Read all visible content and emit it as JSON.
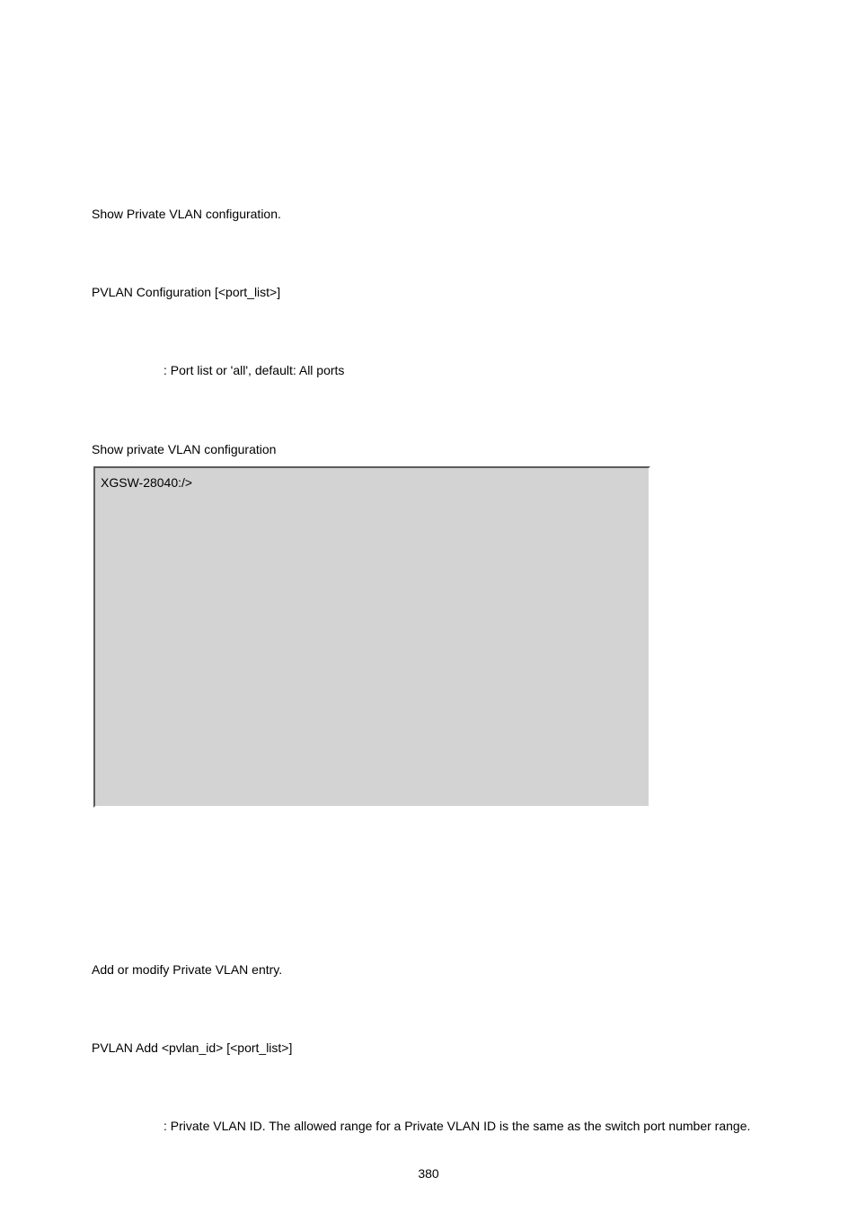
{
  "section1": {
    "desc": "Show Private VLAN configuration.",
    "syntax": "PVLAN Configuration [<port_list>]",
    "param_text": ": Port list or 'all', default: All ports",
    "example_label": "Show private VLAN configuration",
    "prompt": "XGSW-28040:/>"
  },
  "section2": {
    "desc": "Add or modify Private VLAN entry.",
    "syntax": "PVLAN Add <pvlan_id> [<port_list>]",
    "param_text": ": Private VLAN ID. The allowed range for a Private VLAN ID is the same as the switch port number range."
  },
  "page_number": "380"
}
